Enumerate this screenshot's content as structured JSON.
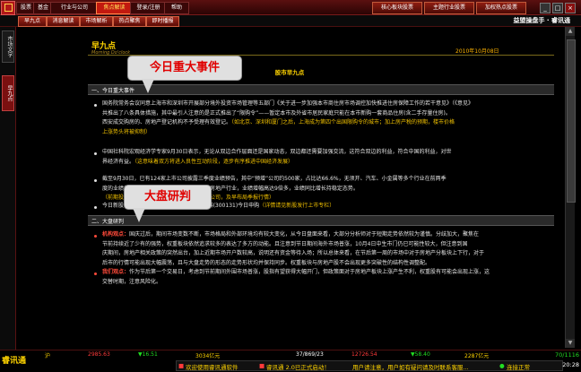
{
  "menu": [
    "股票",
    "基金",
    "行业与公司",
    "焦点解读",
    "登录/注册",
    "帮助"
  ],
  "menu_active_index": 3,
  "top_buttons": [
    "核心板块股票",
    "主题行业股票",
    "加权热点股票"
  ],
  "window_controls": [
    "_",
    "□",
    "×"
  ],
  "tabs": [
    "早九点",
    "消息解读",
    "市场解析",
    "热点聚焦",
    "即时播报"
  ],
  "brand": "益盟操盘手 · 睿讯通",
  "sidebar": {
    "tab1": "市场文字",
    "tab2": "早九点"
  },
  "page": {
    "title": "早九点",
    "subtitle": "Morning Do'clock",
    "date": "2010年10月08日",
    "center_title": "股市早九点"
  },
  "section1": {
    "title": "一、今日重大事件",
    "items": [
      {
        "a": "国务院常务会议同意上海市和深圳市开展部分境外投资市场管理等五部门《关于进一步加强本市商住房市场调控加快推进住房保障工作的若干意见》（《意见》",
        "b": "共推出了八条具体措施，其中最引人注意的是正式推出了“限购令”——暂定本市及外省市居民家庭只能在本市新购一套商品住房(含二手存量住房)。",
        "c": "西安成交购房的、房地产登记机构不予受理有效登记。",
        "d": "（如北京、深圳和厦门之后，上海成为第四个出国限购令的城市；加上房产税的预期，楼市价格",
        "e": "上涨势头将被抑制）"
      },
      {
        "a": "中国社科院宏观经济学专家9月30日表示，无论从双边合作层面还是国家动态，双边都还需要加强交流，这符合双边的利益，符合中国的利益，对世",
        "b": "界经济有益。",
        "c": "（这意味着双方将进入良性互动阶段，逐步有序推进中国经济发展）"
      },
      {
        "a": "截至9月30日，已有124家上市公司披露三季度业绩预告，其中“预增”公司约500家，占比达66.6%，无须开、汽车、小金属等多个行业在前两季",
        "b": "度的业绩增长均超出预期，增长最为强劲的是房地产行业，业绩增幅高达9倍多，业绩同比增长持稳定态势。",
        "c": "（前期投资者可关注三季报预期较好的板块及公司，及早布局季报行情）"
      },
      {
        "a": "今日新股申购：奥拓电子(002587)、天源迪科(300131)今日申购",
        "c": "（详情请见新股发行上市专栏）"
      }
    ]
  },
  "section2": {
    "title": "二、大盘研判",
    "items": [
      {
        "lead": "机构观点：",
        "a": "国庆过后，期间市场变数不断，市场格局和外部环境均有较大变化，从今日盘面来看，大部分分析师对于短期走势依然较为谨慎。分歧加大，聚焦在",
        "b": "节前持续近了少有的强势，权重板块依然追求较多的表达了多方的动能。且注意到节日期间海外市场普涨，10月4日中生市门仍已可能性较大，但注意到国",
        "c": "庆期间，房地产相关政策的突然出台，加上近期市场开户数较高，说明还有资金等待入场；所以总体来看，在节后第一周的市场中对于房地产分板块上下行，对于",
        "d": "后市的行情可能出现大幅震荡，且与大盘走势的形态的走势形状均并保持同步。权重板块与房地产股不会出现更多突破性的结构性调整配。"
      },
      {
        "lead": "我们观点：",
        "a": "作为节后第一个交易日，考虑到节前期间外围市场普涨，股指有望获得大幅开门，但政策面对于房地产板块上涨产生不利，权重股有可能会出现上涨，这",
        "b": "交替时期，注意风险化。"
      }
    ]
  },
  "callouts": {
    "c1": "今日重大事件",
    "c2": "大盘研判"
  },
  "status": {
    "logo": "睿讯通",
    "sh_label": "沪",
    "sh_value": "2985.63",
    "sh_change": "▼16.51",
    "sh_amount": "3034亿元",
    "sz_label": "深",
    "sz_count": "37/869/23",
    "sz_value": "12726.54",
    "sz_change": "▼58.40",
    "sz_amount": "2287亿元",
    "page_counter": "70/1116",
    "clock": "20:28",
    "ticker_welcome": "欢迎使用睿讯通软件",
    "ticker_login": "睿讯通 2.0已正式启动！",
    "ticker_note": "用户请注意，用户如有疑问请及时联系客服...",
    "conn": "连接正常"
  }
}
